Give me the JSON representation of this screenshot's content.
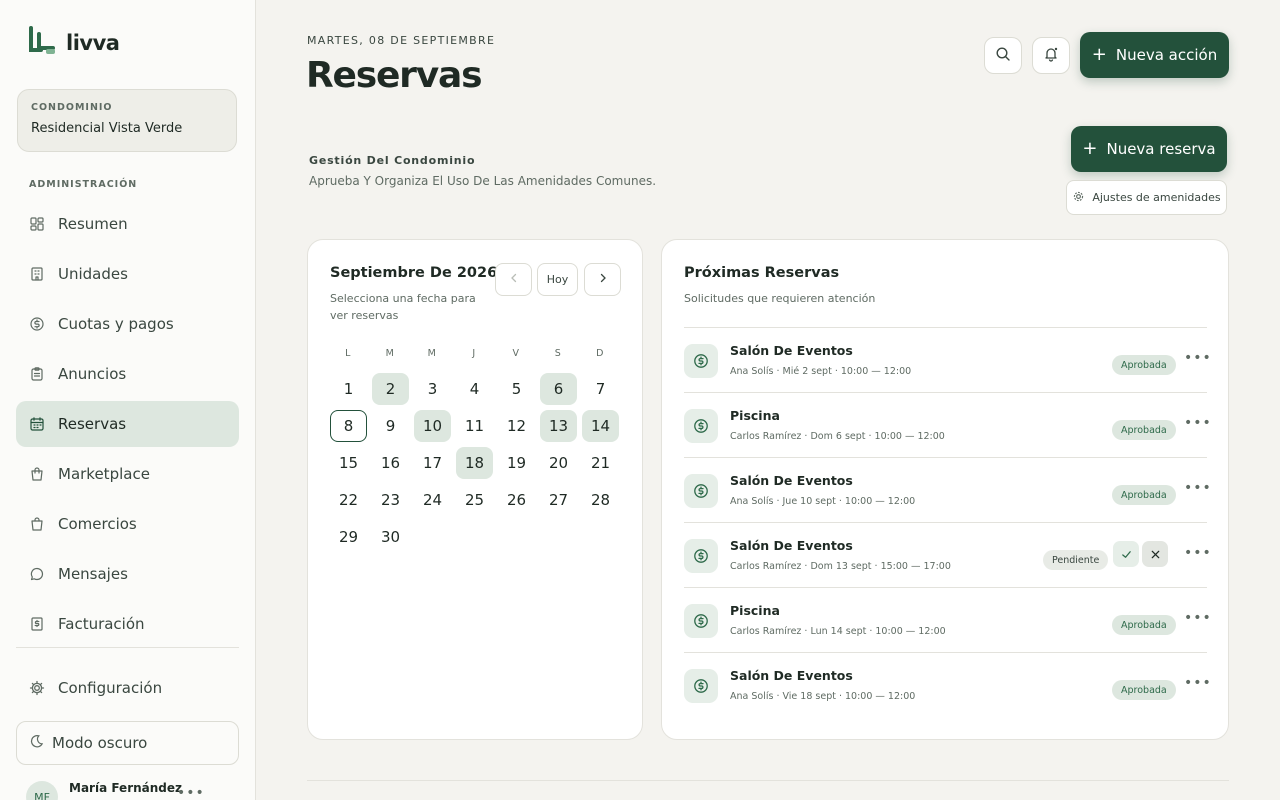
{
  "brand": {
    "name": "livva"
  },
  "condo": {
    "caption": "CONDOMINIO",
    "name": "Residencial Vista Verde"
  },
  "sidebar": {
    "section_label": "ADMINISTRACIÓN",
    "items": [
      {
        "label": "Resumen",
        "icon": "dashboard-icon",
        "active": false
      },
      {
        "label": "Unidades",
        "icon": "building-icon",
        "active": false
      },
      {
        "label": "Cuotas y pagos",
        "icon": "dollar-circle-icon",
        "active": false
      },
      {
        "label": "Anuncios",
        "icon": "clipboard-icon",
        "active": false
      },
      {
        "label": "Reservas",
        "icon": "calendar-icon",
        "active": true
      },
      {
        "label": "Marketplace",
        "icon": "shopping-bag-icon",
        "active": false
      },
      {
        "label": "Comercios",
        "icon": "store-bag-icon",
        "active": false
      },
      {
        "label": "Mensajes",
        "icon": "chat-bubble-icon",
        "active": false
      },
      {
        "label": "Facturación",
        "icon": "invoice-icon",
        "active": false
      }
    ],
    "settings_label": "Configuración",
    "dark_mode_label": "Modo oscuro",
    "user": {
      "initials": "MF",
      "name": "María Fernández"
    }
  },
  "header": {
    "date": "MARTES, 08 DE SEPTIEMBRE",
    "title": "Reservas",
    "new_action_label": "Nueva acción"
  },
  "management": {
    "title": "Gestión Del Condominio",
    "subtitle": "Aprueba Y Organiza El Uso De Las Amenidades Comunes.",
    "new_reservation_label": "Nueva reserva",
    "amenity_settings_label": "Ajustes de amenidades"
  },
  "calendar": {
    "title": "Septiembre De 2026",
    "subtitle": "Selecciona una fecha para ver reservas",
    "today_label": "Hoy",
    "weekdays": [
      "L",
      "M",
      "M",
      "J",
      "V",
      "S",
      "D"
    ],
    "start_offset": 0,
    "days": [
      "1",
      "2",
      "3",
      "4",
      "5",
      "6",
      "7",
      "8",
      "9",
      "10",
      "11",
      "12",
      "13",
      "14",
      "15",
      "16",
      "17",
      "18",
      "19",
      "20",
      "21",
      "22",
      "23",
      "24",
      "25",
      "26",
      "27",
      "28",
      "29",
      "30"
    ],
    "days_with_reservations": [
      "2",
      "6",
      "10",
      "13",
      "14",
      "18"
    ],
    "today": "8"
  },
  "reservations": {
    "title": "Próximas Reservas",
    "subtitle": "Solicitudes que requieren atención",
    "items": [
      {
        "name": "Salón De Eventos",
        "meta": "Ana Solís · Mié 2 sept · 10:00 — 12:00",
        "status": "Aprobada",
        "pending": false
      },
      {
        "name": "Piscina",
        "meta": "Carlos Ramírez · Dom 6 sept · 10:00 — 12:00",
        "status": "Aprobada",
        "pending": false
      },
      {
        "name": "Salón De Eventos",
        "meta": "Ana Solís · Jue 10 sept · 10:00 — 12:00",
        "status": "Aprobada",
        "pending": false
      },
      {
        "name": "Salón De Eventos",
        "meta": "Carlos Ramírez · Dom 13 sept · 15:00 — 17:00",
        "status": "Pendiente",
        "pending": true
      },
      {
        "name": "Piscina",
        "meta": "Carlos Ramírez · Lun 14 sept · 10:00 — 12:00",
        "status": "Aprobada",
        "pending": false
      },
      {
        "name": "Salón De Eventos",
        "meta": "Ana Solís · Vie 18 sept · 10:00 — 12:00",
        "status": "Aprobada",
        "pending": false
      }
    ]
  },
  "colors": {
    "accent": "#23513b",
    "soft_green": "#dde7df",
    "background": "#f4f3ef"
  }
}
